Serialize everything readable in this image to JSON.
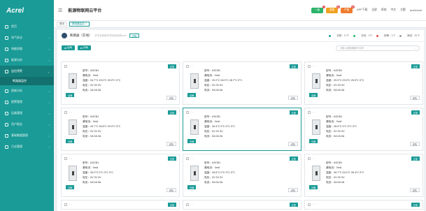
{
  "app": {
    "logo": "Acrel",
    "title": "能源物联网云平台",
    "menu_icon": "menu-icon"
  },
  "topbar": {
    "pills": [
      {
        "label": "一级",
        "badge": "7",
        "color": "#2db36b"
      },
      {
        "label": "重要",
        "badge": "19",
        "color": "#f0a020"
      },
      {
        "label": "严重",
        "badge": "43",
        "color": "#ef7c2f"
      }
    ],
    "links": [
      "APP下载",
      "全屏",
      "帮助",
      "中文",
      "主题",
      "acrelcloud"
    ]
  },
  "sidebar": {
    "items": [
      {
        "label": "首页"
      },
      {
        "label": "电气安全",
        "chev": "›"
      },
      {
        "label": "电能质量",
        "chev": "›"
      },
      {
        "label": "能源分析",
        "chev": "›"
      },
      {
        "label": "监控预警",
        "chev": "⌄",
        "active": true
      },
      {
        "label": "断路器监控",
        "sub": true
      },
      {
        "label": "损耗分析",
        "chev": "›"
      },
      {
        "label": "报警管理",
        "chev": "›"
      },
      {
        "label": "运维管理",
        "chev": "›"
      },
      {
        "label": "用户报告",
        "chev": "›"
      },
      {
        "label": "基础数据管理",
        "chev": "›"
      },
      {
        "label": "日志管理",
        "chev": "›"
      }
    ]
  },
  "tabs": [
    {
      "label": "首页"
    },
    {
      "label": "断路器监控 ×",
      "active": true
    }
  ],
  "device": {
    "name": "断路器（在线）",
    "desc": "开关名称和开关状态说明xxxx",
    "change": "切换"
  },
  "stats": [
    {
      "label": "总数：17个",
      "color": "#1a9b97"
    },
    {
      "label": "在线：0个",
      "color": "#2db36b"
    },
    {
      "label": "报警：1个",
      "color": "#e64b4b"
    },
    {
      "label": "离线：67个",
      "color": "#999999"
    }
  ],
  "actions": {
    "open": "合闸",
    "close": "分闸"
  },
  "search": {
    "placeholder": "请输入断路器编号/名称",
    "icon": "search-icon"
  },
  "cards": [
    {
      "model": "型号：ASCB1",
      "leak": "漏电流：0mA",
      "temp": "温度：26.7°C 29.0°C 29.0°C 0°C",
      "volt": "电压：0V 0V 0V",
      "curr": "电流：0A 0A 0A",
      "status": "正常",
      "btn": "合闸",
      "detail": "详情"
    },
    {
      "model": "型号：ASCB1",
      "leak": "漏电流：0mA",
      "temp": "温度：29.0°C 26.0°C 28.7°C 0°C",
      "volt": "电压：0V 0V 0V",
      "curr": "电流：0A 0A 0A",
      "status": "正常",
      "btn": "合闸",
      "detail": "详情"
    },
    {
      "model": "型号：ASCB1",
      "leak": "漏电流：0mA",
      "temp": "温度：29.0°C 29.5°C 29.5°C 0°C",
      "volt": "电压：0V 0V 0V",
      "curr": "电流：0A 0A 0A",
      "status": "正常",
      "btn": "合闸",
      "detail": "详情"
    },
    {
      "model": "型号：ASCB1",
      "leak": "漏电流：0mA",
      "temp": "温度：26.7°C 28.8°C 29.0°C 0°C",
      "volt": "电压：0V 0V 0V",
      "curr": "电流：0A 0A 0A",
      "status": "正常",
      "btn": "分闸",
      "detail": "详情"
    },
    {
      "model": "型号：ASCB1",
      "leak": "漏电流：0mA",
      "temp": "温度：28.4°C 0°C 0°C 0°C",
      "volt": "电压：0V 0V 0V",
      "curr": "电流：0A 0A 0A",
      "status": "正常",
      "btn": "分闸",
      "detail": "详情"
    },
    {
      "model": "型号：ASCB1",
      "leak": "漏电流：0mA",
      "temp": "温度：28.0°C 0°C 0°C 0°C",
      "volt": "电压：0V 0V 0V",
      "curr": "电流：0A 0A 0A",
      "status": "正常",
      "btn": "分闸",
      "detail": "详情"
    },
    {
      "model": "型号：ASCB1",
      "leak": "漏电流：0mA",
      "temp": "温度：30.0°C 0°C 0°C 0°C",
      "volt": "电压：0V 0V 0V",
      "curr": "电流：0A 0A 0A",
      "status": "正常",
      "btn": "分闸",
      "detail": "详情"
    },
    {
      "model": "型号：ASCB1",
      "leak": "漏电流：0mA",
      "temp": "温度：26.6°C 0°C 0°C 0°C",
      "volt": "电压：0V 0V 0V",
      "curr": "电流：0A 0A 0A",
      "status": "正常",
      "btn": "分闸",
      "detail": "详情"
    },
    {
      "model": "型号：ASCB1",
      "leak": "漏电流：0mA",
      "temp": "温度：28.7°C 29.4°C 28.4°C 0°C",
      "volt": "电压：0V 0V 0V",
      "curr": "电流：0A 0A 0A",
      "status": "正常",
      "btn": "分闸",
      "detail": "详情"
    },
    {
      "status": "正常"
    },
    {
      "status": "正常"
    },
    {
      "status": "正常"
    }
  ]
}
